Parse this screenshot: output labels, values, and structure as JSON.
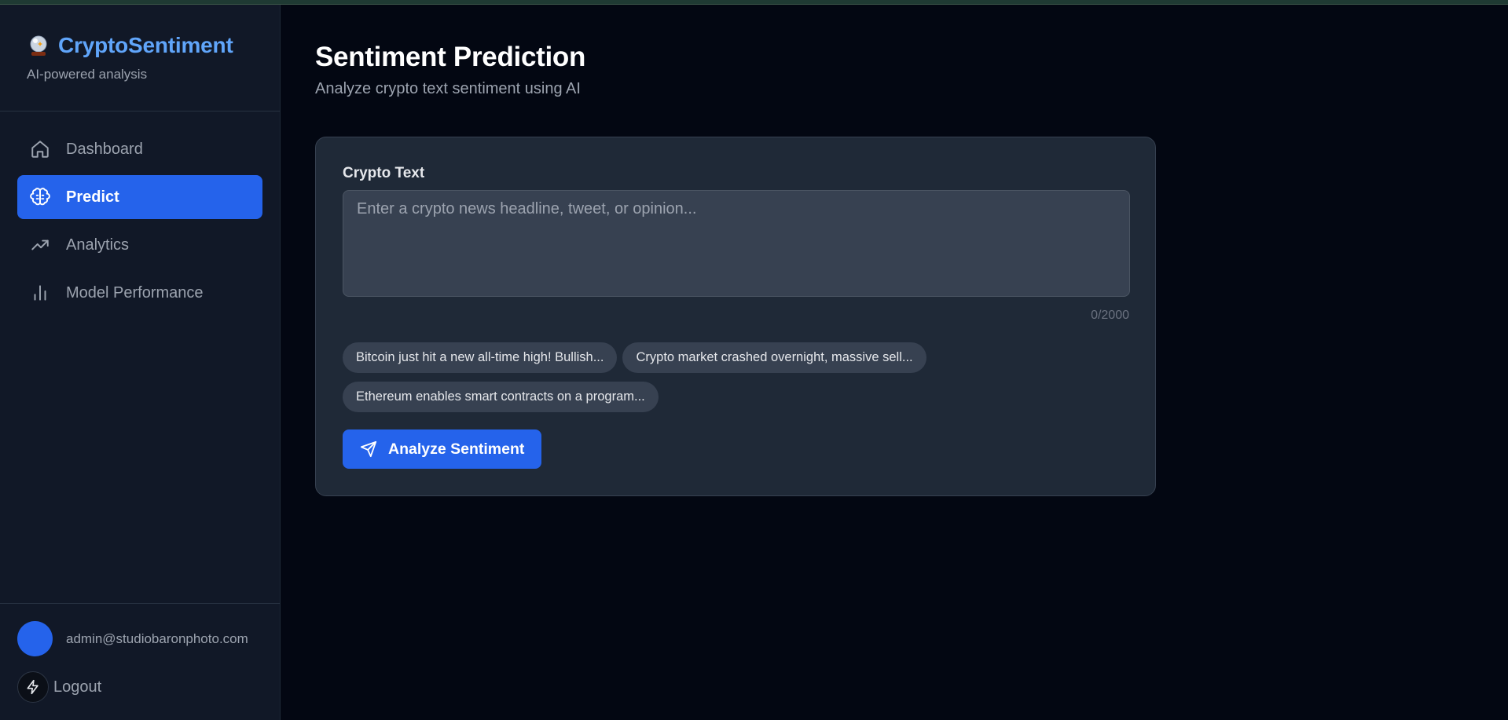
{
  "brand": {
    "title": "CryptoSentiment",
    "subtitle": "AI-powered analysis",
    "icon": "crystal-ball-emoji"
  },
  "nav": {
    "items": [
      {
        "label": "Dashboard",
        "icon": "home-icon"
      },
      {
        "label": "Predict",
        "icon": "brain-icon",
        "active": true
      },
      {
        "label": "Analytics",
        "icon": "trending-up-icon"
      },
      {
        "label": "Model Performance",
        "icon": "bar-chart-icon"
      }
    ]
  },
  "user": {
    "email": "admin@studiobaronphoto.com",
    "logout_label": "Logout"
  },
  "page": {
    "title": "Sentiment Prediction",
    "subtitle": "Analyze crypto text sentiment using AI"
  },
  "form": {
    "label": "Crypto Text",
    "value": "",
    "placeholder": "Enter a crypto news headline, tweet, or opinion...",
    "counter": "0/2000",
    "examples": [
      "Bitcoin just hit a new all-time high! Bullish...",
      "Crypto market crashed overnight, massive sell...",
      "Ethereum enables smart contracts on a program..."
    ],
    "submit_label": "Analyze Sentiment"
  },
  "colors": {
    "accent": "#2563eb",
    "brand": "#60a5fa",
    "background": "#030712",
    "sidebar": "#111827",
    "card": "#1f2937"
  }
}
